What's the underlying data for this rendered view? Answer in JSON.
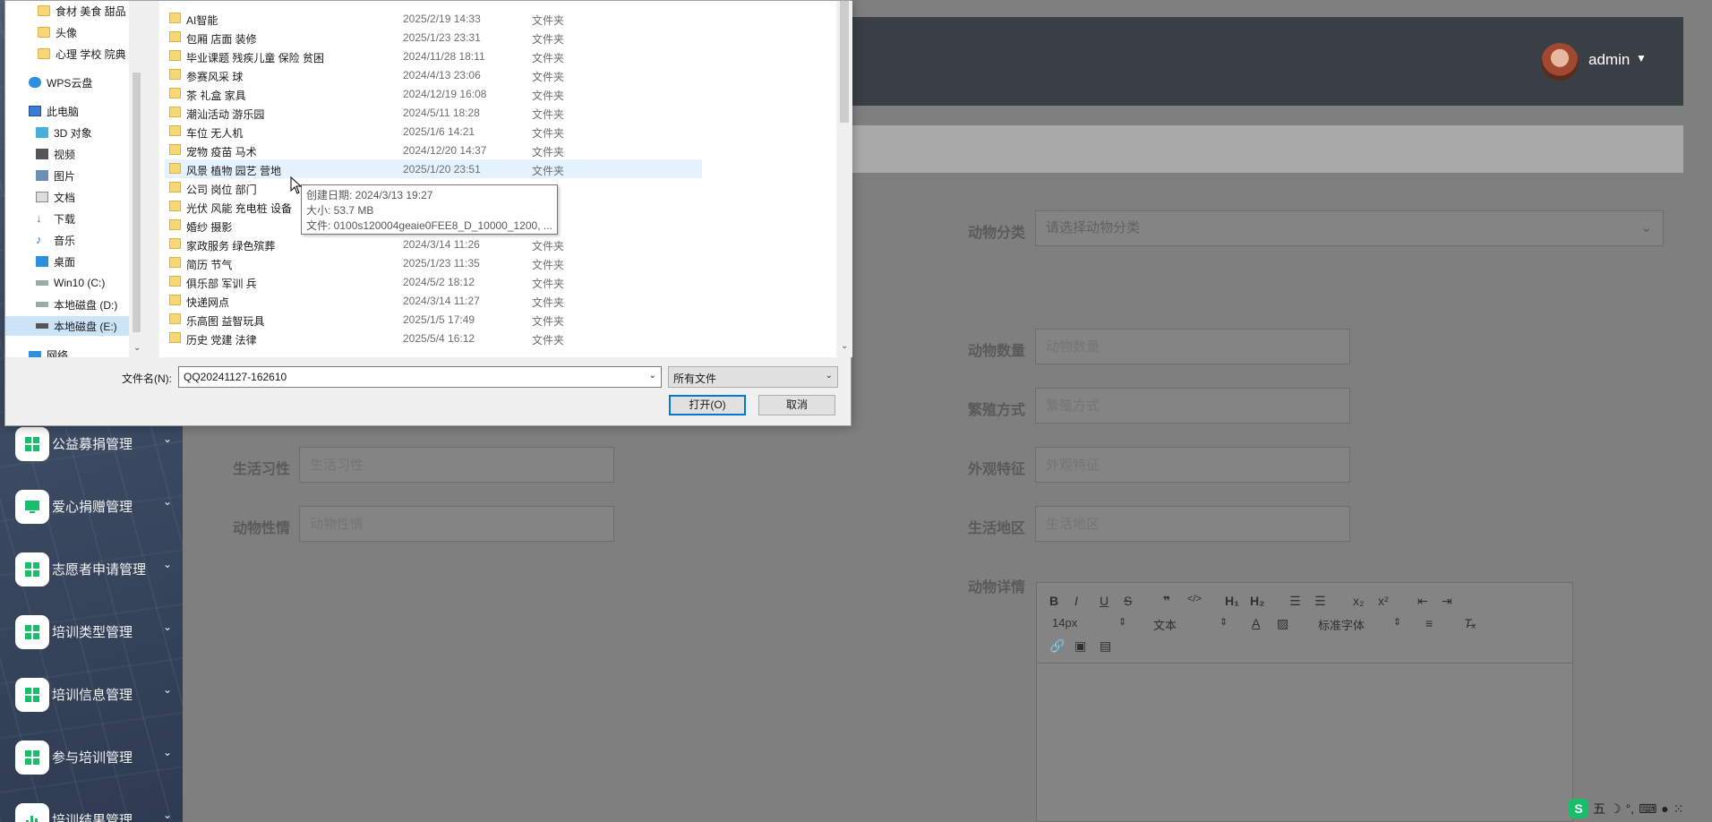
{
  "sidebar": {
    "items": [
      {
        "label": "公益募捐管理",
        "icon": "grid-icon"
      },
      {
        "label": "爱心捐赠管理",
        "icon": "monitor-icon"
      },
      {
        "label": "志愿者申请管理",
        "icon": "grid-icon"
      },
      {
        "label": "培训类型管理",
        "icon": "grid-icon"
      },
      {
        "label": "培训信息管理",
        "icon": "grid-icon"
      },
      {
        "label": "参与培训管理",
        "icon": "grid-icon"
      },
      {
        "label": "培训结果管理",
        "icon": "chart-icon"
      }
    ]
  },
  "header": {
    "user": "admin"
  },
  "form": {
    "category_label": "动物分类",
    "category_placeholder": "请选择动物分类",
    "count_label": "动物数量",
    "count_placeholder": "动物数量",
    "breeding_label": "繁殖方式",
    "breeding_placeholder": "繁殖方式",
    "habits_label": "生活习性",
    "habits_placeholder": "生活习性",
    "appearance_label": "外观特征",
    "appearance_placeholder": "外观特征",
    "temper_label": "动物性情",
    "temper_placeholder": "动物性情",
    "region_label": "生活地区",
    "region_placeholder": "生活地区",
    "detail_label": "动物详情"
  },
  "editor": {
    "font_size": "14px",
    "block_format": "文本",
    "font_family": "标准字体"
  },
  "dialog": {
    "nav": [
      {
        "label": "食材 美食 甜品 ",
        "icon": "folder-icon"
      },
      {
        "label": "头像",
        "icon": "folder-icon"
      },
      {
        "label": "心理 学校 院典",
        "icon": "folder-icon"
      },
      {
        "label": "WPS云盘",
        "icon": "cloud-icon"
      },
      {
        "label": "此电脑",
        "icon": "computer-icon"
      },
      {
        "label": "3D 对象",
        "icon": "cube-icon"
      },
      {
        "label": "视频",
        "icon": "video-icon"
      },
      {
        "label": "图片",
        "icon": "image-icon"
      },
      {
        "label": "文档",
        "icon": "document-icon"
      },
      {
        "label": "下载",
        "icon": "download-icon"
      },
      {
        "label": "音乐",
        "icon": "music-icon"
      },
      {
        "label": "桌面",
        "icon": "desktop-icon"
      },
      {
        "label": "Win10 (C:)",
        "icon": "drive-icon"
      },
      {
        "label": "本地磁盘 (D:)",
        "icon": "drive-icon"
      },
      {
        "label": "本地磁盘 (E:)",
        "icon": "drive-icon"
      },
      {
        "label": "网络",
        "icon": "network-icon"
      }
    ],
    "files": [
      {
        "name": "AI智能",
        "date": "2025/2/19 14:33",
        "type": "文件夹"
      },
      {
        "name": "包厢  店面  装修",
        "date": "2025/1/23 23:31",
        "type": "文件夹"
      },
      {
        "name": "毕业课题  残疾儿童  保险  贫困",
        "date": "2024/11/28 18:11",
        "type": "文件夹"
      },
      {
        "name": "参赛风采  球",
        "date": "2024/4/13 23:06",
        "type": "文件夹"
      },
      {
        "name": "茶  礼盒  家具",
        "date": "2024/12/19 16:08",
        "type": "文件夹"
      },
      {
        "name": "潮汕活动  游乐园",
        "date": "2024/5/11 18:28",
        "type": "文件夹"
      },
      {
        "name": "车位  无人机",
        "date": "2025/1/6 14:21",
        "type": "文件夹"
      },
      {
        "name": "宠物  疫苗  马术",
        "date": "2024/12/20 14:37",
        "type": "文件夹"
      },
      {
        "name": "风景  植物  园艺  营地",
        "date": "2025/1/20 23:51",
        "type": "文件夹"
      },
      {
        "name": "公司  岗位  部门",
        "date": "",
        "type": ""
      },
      {
        "name": "光伏  风能  充电桩  设备",
        "date": "",
        "type": ""
      },
      {
        "name": "婚纱  摄影",
        "date": "",
        "type": ""
      },
      {
        "name": "家政服务  绿色殡葬",
        "date": "2024/3/14 11:26",
        "type": "文件夹"
      },
      {
        "name": "简历  节气",
        "date": "2025/1/23 11:35",
        "type": "文件夹"
      },
      {
        "name": "俱乐部  军训  兵",
        "date": "2024/5/2 18:12",
        "type": "文件夹"
      },
      {
        "name": "快递网点",
        "date": "2024/3/14 11:27",
        "type": "文件夹"
      },
      {
        "name": "乐高图  益智玩具",
        "date": "2025/1/5 17:49",
        "type": "文件夹"
      },
      {
        "name": "历史  党建  法律",
        "date": "2025/5/4 16:12",
        "type": "文件夹"
      }
    ],
    "tooltip": {
      "created": "创建日期: 2024/3/13 19:27",
      "size": "大小: 53.7 MB",
      "files": "文件: 0100s120004geaie0FEE8_D_10000_1200, ..."
    },
    "filename_label": "文件名(N):",
    "filename_value": "QQ20241127-162610",
    "filetype_value": "所有文件",
    "open_label": "打开(O)",
    "cancel_label": "取消"
  },
  "ime": {
    "label": "五"
  },
  "colors": {
    "topbar": "#3a3f46",
    "accent": "#0078d7",
    "folder": "#f8d775",
    "tooltip_bg": "#ffffff"
  }
}
